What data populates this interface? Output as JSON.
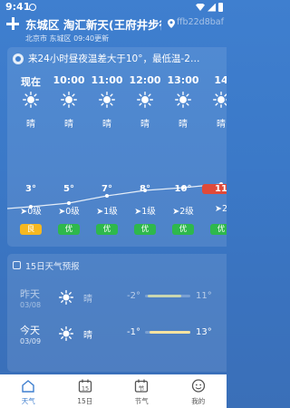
{
  "status_bar": {
    "time": "9:41"
  },
  "header": {
    "title": "东城区 淘汇新天(王府井步行…",
    "subtitle": "北京市 东城区 09:40更新",
    "user_id": "ffb22d8baf"
  },
  "banner": {
    "text": "来24小时昼夜温差大于10°，最低温-2…"
  },
  "hourly": [
    {
      "time": "现在",
      "cond": "晴",
      "temp": "3°",
      "wind": "0级",
      "aqi": "良",
      "aqi_level": "good"
    },
    {
      "time": "10:00",
      "cond": "晴",
      "temp": "5°",
      "wind": "0级",
      "aqi": "优",
      "aqi_level": "excellent"
    },
    {
      "time": "11:00",
      "cond": "晴",
      "temp": "7°",
      "wind": "1级",
      "aqi": "优",
      "aqi_level": "excellent"
    },
    {
      "time": "12:00",
      "cond": "晴",
      "temp": "8°",
      "wind": "1级",
      "aqi": "优",
      "aqi_level": "excellent"
    },
    {
      "time": "13:00",
      "cond": "晴",
      "temp": "10°",
      "wind": "2级",
      "aqi": "优",
      "aqi_level": "excellent"
    },
    {
      "time": "14",
      "cond": "晴",
      "temp": "11",
      "wind": "2",
      "aqi": "优",
      "aqi_level": "excellent"
    }
  ],
  "daily": {
    "title": "15日天气预报",
    "days": [
      {
        "name": "昨天",
        "date": "03/08",
        "cond": "晴",
        "low": "-2°",
        "high": "11°",
        "bar_start": 0.05,
        "bar_end": 0.8,
        "bar_color": "#c9d6b0"
      },
      {
        "name": "今天",
        "date": "03/09",
        "cond": "晴",
        "low": "-1°",
        "high": "13°",
        "bar_start": 0.1,
        "bar_end": 1.0,
        "bar_color": "#f7e3a0"
      }
    ]
  },
  "nav": {
    "items": [
      {
        "label": "天气",
        "icon": "weather-home-icon",
        "active": true
      },
      {
        "label": "15日",
        "icon": "calendar-15-icon",
        "icon_text": "15",
        "active": false
      },
      {
        "label": "节气",
        "icon": "solar-term-icon",
        "icon_text": "节",
        "active": false
      },
      {
        "label": "我的",
        "icon": "profile-icon",
        "active": false
      }
    ]
  },
  "colors": {
    "background": "#3f7fcf",
    "aqi_good": "#f5b821",
    "aqi_excellent": "#2eb84c",
    "temp_highlight": "#e04a3a",
    "active_tab": "#3f7fcf"
  }
}
